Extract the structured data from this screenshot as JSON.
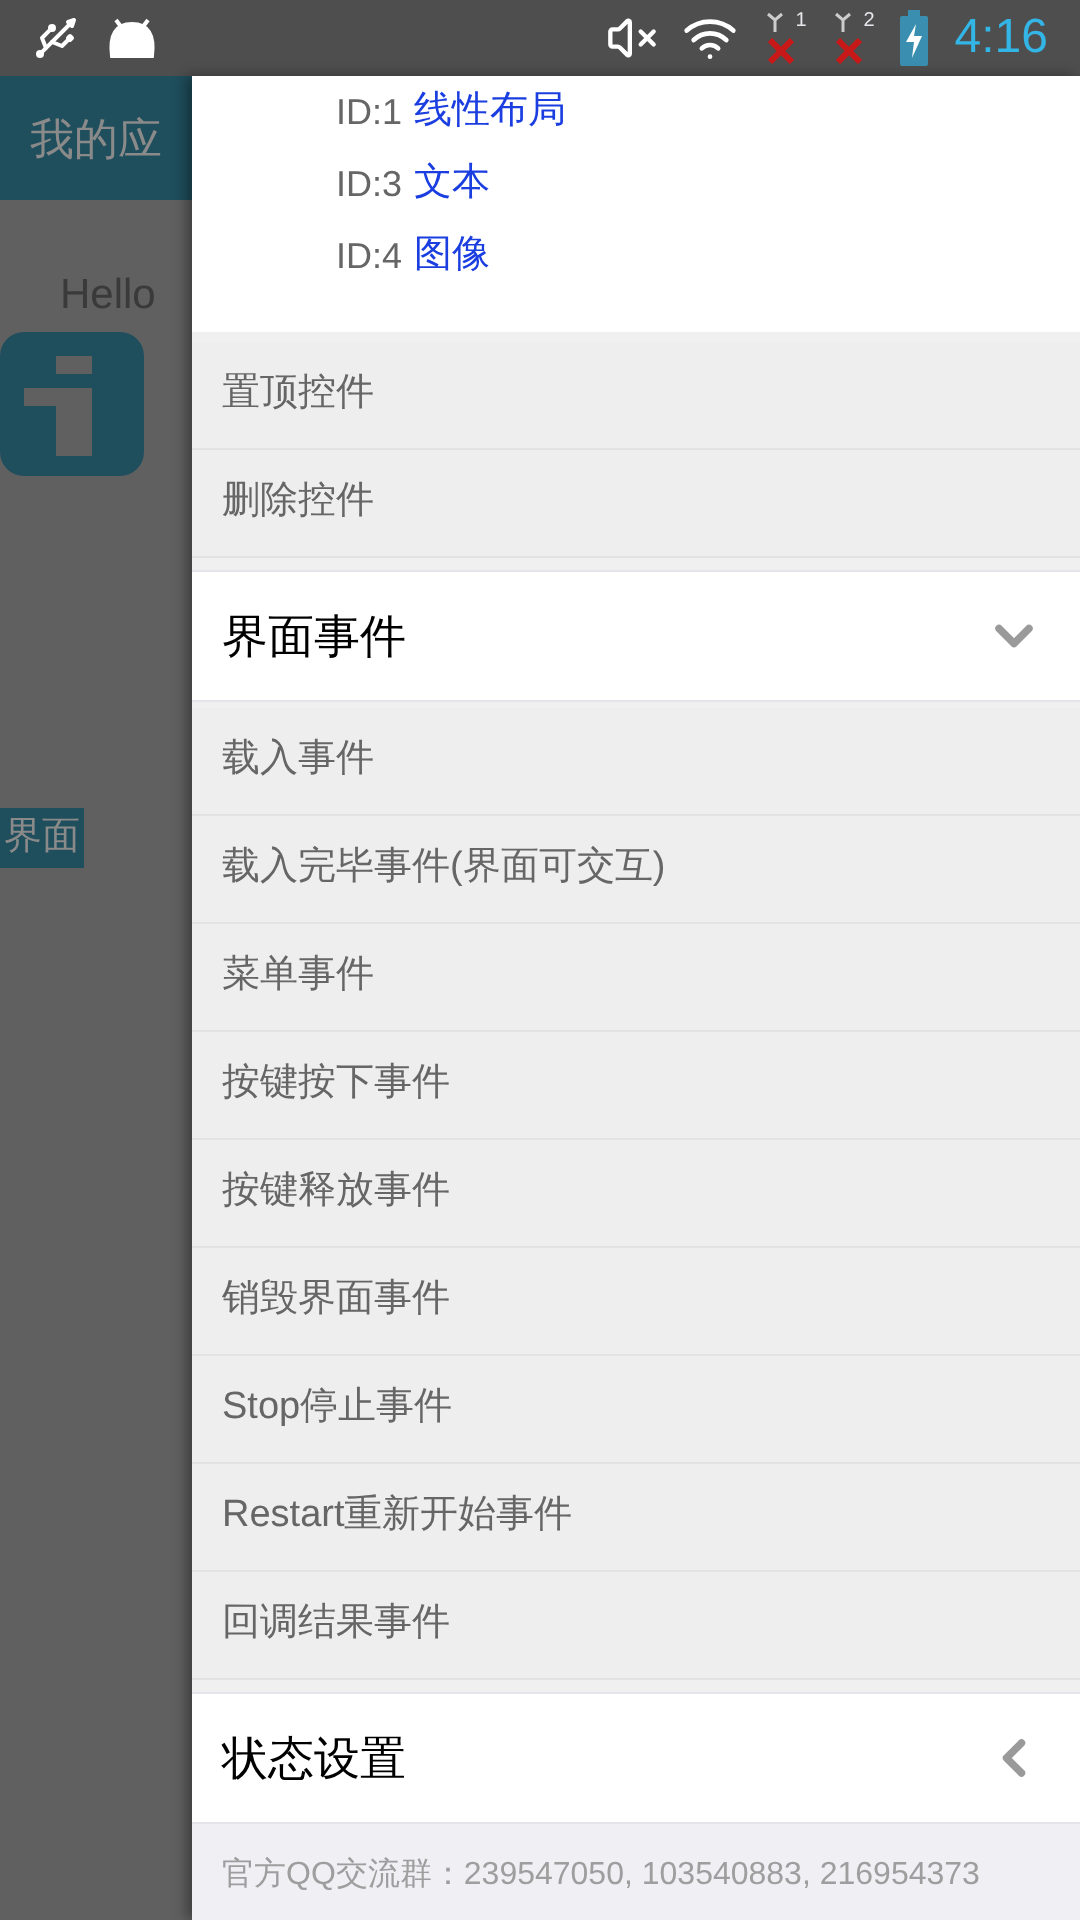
{
  "status_bar": {
    "time": "4:16",
    "sim_1": "1",
    "sim_2": "2"
  },
  "background_app": {
    "title": "我的应",
    "hello": "Hello",
    "label": "界面"
  },
  "drawer": {
    "id_rows": [
      {
        "id": "ID:1",
        "name": "线性布局"
      },
      {
        "id": "ID:3",
        "name": "文本"
      },
      {
        "id": "ID:4",
        "name": "图像"
      }
    ],
    "actions": [
      "置顶控件",
      "删除控件"
    ],
    "groups": [
      {
        "title": "界面事件",
        "expanded": true,
        "items": [
          "载入事件",
          "载入完毕事件(界面可交互)",
          "菜单事件",
          "按键按下事件",
          "按键释放事件",
          "销毁界面事件",
          "Stop停止事件",
          "Restart重新开始事件",
          "回调结果事件"
        ]
      },
      {
        "title": "状态设置",
        "expanded": false
      }
    ],
    "footer": "官方QQ交流群：239547050, 103540883, 216954373"
  }
}
